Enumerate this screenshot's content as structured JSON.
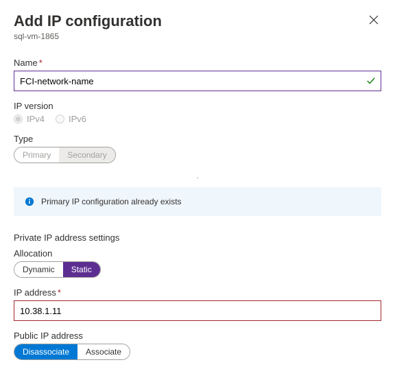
{
  "header": {
    "title": "Add IP configuration",
    "subtitle": "sql-vm-1865"
  },
  "nameField": {
    "label": "Name",
    "required": "*",
    "value": "FCI-network-name"
  },
  "ipVersion": {
    "label": "IP version",
    "options": {
      "v4": "IPv4",
      "v6": "IPv6"
    }
  },
  "typeField": {
    "label": "Type",
    "options": {
      "primary": "Primary",
      "secondary": "Secondary"
    }
  },
  "infoNote": "Primary IP configuration already exists",
  "privateSection": {
    "title": "Private IP address settings",
    "allocation": {
      "label": "Allocation",
      "options": {
        "dynamic": "Dynamic",
        "static": "Static"
      }
    },
    "ipAddress": {
      "label": "IP address",
      "required": "*",
      "value": "10.38.1.11"
    }
  },
  "publicSection": {
    "label": "Public IP address",
    "options": {
      "disassociate": "Disassociate",
      "associate": "Associate"
    }
  }
}
